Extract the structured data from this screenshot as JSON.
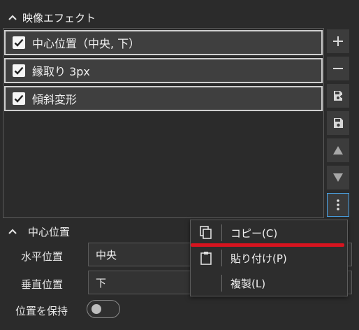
{
  "effects_section": {
    "title": "映像エフェクト"
  },
  "effects": [
    {
      "label": "中心位置（中央, 下）",
      "checked": true
    },
    {
      "label": "縁取り 3px",
      "checked": true
    },
    {
      "label": "傾斜変形",
      "checked": true
    }
  ],
  "toolbar": {
    "buttons": [
      "plus-icon",
      "minus-icon",
      "save-as-icon",
      "save-icon",
      "triangle-up-icon",
      "triangle-down-icon",
      "more-vertical-icon"
    ],
    "active_button": "more-vertical-icon",
    "active_border_color": "#4aa3e6"
  },
  "properties_section": {
    "title": "中心位置",
    "horizontal": {
      "label": "水平位置",
      "value": "中央"
    },
    "vertical": {
      "label": "垂直位置",
      "value": "下"
    },
    "keep_position": {
      "label": "位置を保持",
      "on": false
    }
  },
  "context_menu": {
    "items": [
      {
        "icon": "copy-icon",
        "label": "コピー(C)"
      },
      {
        "icon": "clipboard-icon",
        "label": "貼り付け(P)"
      },
      {
        "icon": "",
        "label": "複製(L)"
      }
    ],
    "highlight_color": "#d6141f"
  }
}
